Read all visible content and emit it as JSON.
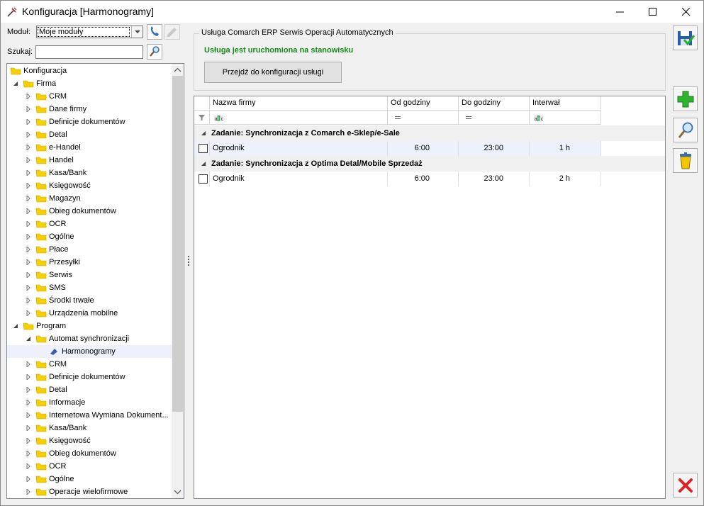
{
  "window": {
    "title": "Konfiguracja [Harmonogramy]"
  },
  "toolbar": {
    "module_label": "Moduł:",
    "module_value": "Moje moduły",
    "search_label": "Szukaj:",
    "search_value": ""
  },
  "tree": [
    {
      "label": "Konfiguracja",
      "level": 0,
      "expander": "none"
    },
    {
      "label": "Firma",
      "level": 1,
      "expander": "open"
    },
    {
      "label": "CRM",
      "level": 2,
      "expander": "closed"
    },
    {
      "label": "Dane firmy",
      "level": 2,
      "expander": "closed"
    },
    {
      "label": "Definicje dokumentów",
      "level": 2,
      "expander": "closed"
    },
    {
      "label": "Detal",
      "level": 2,
      "expander": "closed"
    },
    {
      "label": "e-Handel",
      "level": 2,
      "expander": "closed"
    },
    {
      "label": "Handel",
      "level": 2,
      "expander": "closed"
    },
    {
      "label": "Kasa/Bank",
      "level": 2,
      "expander": "closed"
    },
    {
      "label": "Księgowość",
      "level": 2,
      "expander": "closed"
    },
    {
      "label": "Magazyn",
      "level": 2,
      "expander": "closed"
    },
    {
      "label": "Obieg dokumentów",
      "level": 2,
      "expander": "closed"
    },
    {
      "label": "OCR",
      "level": 2,
      "expander": "closed"
    },
    {
      "label": "Ogólne",
      "level": 2,
      "expander": "closed"
    },
    {
      "label": "Płace",
      "level": 2,
      "expander": "closed"
    },
    {
      "label": "Przesyłki",
      "level": 2,
      "expander": "closed"
    },
    {
      "label": "Serwis",
      "level": 2,
      "expander": "closed"
    },
    {
      "label": "SMS",
      "level": 2,
      "expander": "closed"
    },
    {
      "label": "Środki trwałe",
      "level": 2,
      "expander": "closed"
    },
    {
      "label": "Urządzenia mobilne",
      "level": 2,
      "expander": "closed"
    },
    {
      "label": "Program",
      "level": 1,
      "expander": "open"
    },
    {
      "label": "Automat synchronizacji",
      "level": 2,
      "expander": "open"
    },
    {
      "label": "Harmonogramy",
      "level": 3,
      "expander": "none",
      "leaf": true,
      "selected": true
    },
    {
      "label": "CRM",
      "level": 2,
      "expander": "closed"
    },
    {
      "label": "Definicje dokumentów",
      "level": 2,
      "expander": "closed"
    },
    {
      "label": "Detal",
      "level": 2,
      "expander": "closed"
    },
    {
      "label": "Informacje",
      "level": 2,
      "expander": "closed"
    },
    {
      "label": "Internetowa Wymiana Dokument...",
      "level": 2,
      "expander": "closed"
    },
    {
      "label": "Kasa/Bank",
      "level": 2,
      "expander": "closed"
    },
    {
      "label": "Księgowość",
      "level": 2,
      "expander": "closed"
    },
    {
      "label": "Obieg dokumentów",
      "level": 2,
      "expander": "closed"
    },
    {
      "label": "OCR",
      "level": 2,
      "expander": "closed"
    },
    {
      "label": "Ogólne",
      "level": 2,
      "expander": "closed"
    },
    {
      "label": "Operacje wielofirmowe",
      "level": 2,
      "expander": "closed"
    }
  ],
  "service": {
    "group_title": "Usługa Comarch ERP Serwis Operacji Automatycznych",
    "status": "Usługa jest uruchomiona na stanowisku",
    "config_button": "Przejdź do konfiguracji usługi"
  },
  "grid": {
    "columns": [
      "Nazwa firmy",
      "Od godziny",
      "Do godziny",
      "Interwał"
    ],
    "filter_types": [
      "abc",
      "eq",
      "eq",
      "abc"
    ],
    "groups": [
      {
        "title": "Zadanie: Synchronizacja z Comarch e-Sklep/e-Sale",
        "rows": [
          {
            "firm": "Ogrodnik",
            "from": "6:00",
            "to": "23:00",
            "interval": "1 h",
            "selected": true
          }
        ]
      },
      {
        "title": "Zadanie: Synchronizacja z Optima Detal/Mobile Sprzedaż",
        "rows": [
          {
            "firm": "Ogrodnik",
            "from": "6:00",
            "to": "23:00",
            "interval": "2 h",
            "selected": false
          }
        ]
      }
    ]
  },
  "colors": {
    "status_green": "#188a18",
    "folder_yellow": "#f5d000",
    "selection": "#eef1fb"
  }
}
